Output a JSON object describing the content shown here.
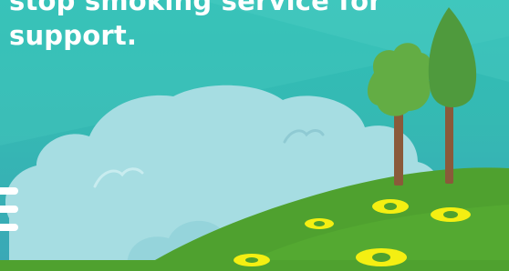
{
  "message": {
    "line1": "stop smoking service for",
    "line2": "support."
  },
  "colors": {
    "sky_top": "#2fbfb6",
    "sky_bottom": "#3aa7b6",
    "cloud": "#a6dde2",
    "hill": "#4fa12f",
    "hill_light": "#5bb336",
    "tree_round": "#63ad44",
    "tree_tall": "#4f9a3d",
    "trunk": "#8a5a3a",
    "flower": "#f4ef12"
  },
  "icons": [
    "menu-icon"
  ]
}
